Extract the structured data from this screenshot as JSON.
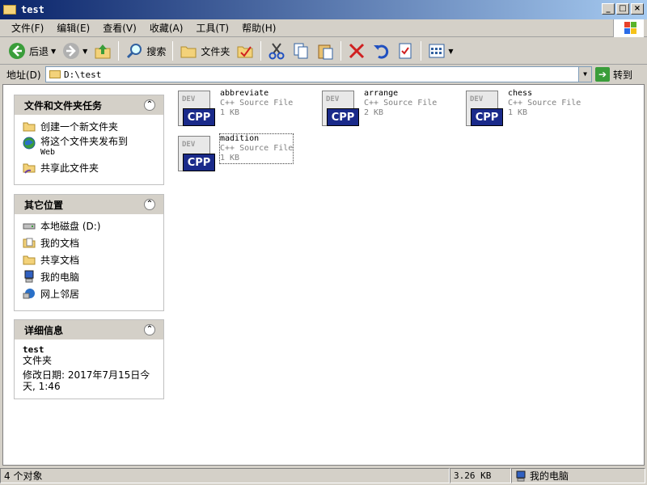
{
  "window": {
    "title": "test"
  },
  "menu": [
    "文件(F)",
    "编辑(E)",
    "查看(V)",
    "收藏(A)",
    "工具(T)",
    "帮助(H)"
  ],
  "toolbar": {
    "back_label": "后退",
    "search_label": "搜索",
    "folders_label": "文件夹"
  },
  "address": {
    "label": "地址(D)",
    "value": "D:\\test",
    "go_label": "转到"
  },
  "panels": {
    "tasks": {
      "title": "文件和文件夹任务",
      "items": [
        "创建一个新文件夹",
        "将这个文件夹发布到",
        "Web",
        "共享此文件夹"
      ]
    },
    "places": {
      "title": "其它位置",
      "items": [
        "本地磁盘 (D:)",
        "我的文档",
        "共享文档",
        "我的电脑",
        "网上邻居"
      ]
    },
    "details": {
      "title": "详细信息",
      "name": "test",
      "type": "文件夹",
      "modified_line1": "修改日期: 2017年7月15日今",
      "modified_line2": "天, 1:46"
    }
  },
  "files": [
    {
      "name": "abbreviate",
      "type": "C++ Source File",
      "size": "1 KB"
    },
    {
      "name": "arrange",
      "type": "C++ Source File",
      "size": "2 KB"
    },
    {
      "name": "chess",
      "type": "C++ Source File",
      "size": "1 KB"
    },
    {
      "name": "madition",
      "type": "C++ Source File",
      "size": "1 KB"
    }
  ],
  "file_icon": {
    "badge": "CPP",
    "watermark": "DEV"
  },
  "status": {
    "count": "4 个对象",
    "size": "3.26 KB",
    "location": "我的电脑"
  },
  "colors": {
    "title_start": "#0a246a",
    "title_end": "#a6caf0",
    "cpp_badge": "#1a2a8a"
  }
}
